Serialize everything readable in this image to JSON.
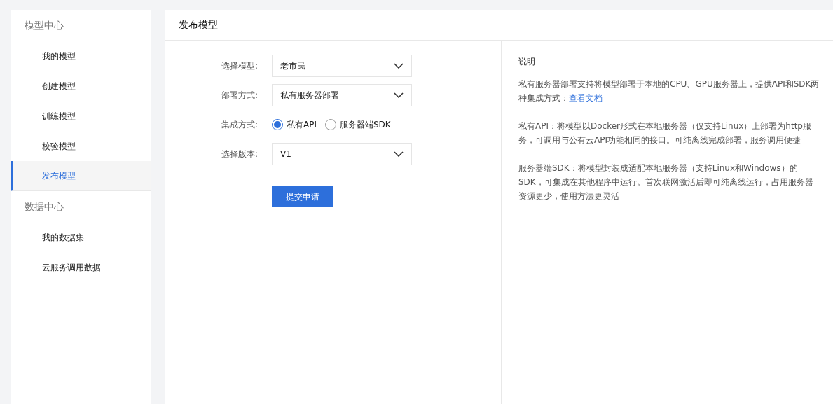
{
  "sidebar": {
    "groups": [
      {
        "title": "模型中心",
        "items": [
          {
            "label": "我的模型",
            "selected": false
          },
          {
            "label": "创建模型",
            "selected": false
          },
          {
            "label": "训练模型",
            "selected": false
          },
          {
            "label": "校验模型",
            "selected": false
          },
          {
            "label": "发布模型",
            "selected": true
          }
        ]
      },
      {
        "title": "数据中心",
        "items": [
          {
            "label": "我的数据集",
            "selected": false
          },
          {
            "label": "云服务调用数据",
            "selected": false
          }
        ]
      }
    ]
  },
  "page_title": "发布模型",
  "form": {
    "fields": [
      {
        "kind": "select",
        "label": "选择模型:",
        "value": "老市民"
      },
      {
        "kind": "select",
        "label": "部署方式:",
        "value": "私有服务器部署"
      },
      {
        "kind": "radio",
        "label": "集成方式:",
        "options": [
          {
            "label": "私有API",
            "selected": true
          },
          {
            "label": "服务器端SDK",
            "selected": false
          }
        ]
      },
      {
        "kind": "select",
        "label": "选择版本:",
        "value": "V1"
      }
    ],
    "submit": "提交申请"
  },
  "info": {
    "title": "说明",
    "paragraphs": [
      {
        "text": "私有服务器部署支持将模型部署于本地的CPU、GPU服务器上，提供API和SDK两种集成方式：",
        "link": "查看文档"
      },
      {
        "text": "私有API：将模型以Docker形式在本地服务器（仅支持Linux）上部署为http服务，可调用与公有云API功能相同的接口。可纯离线完成部署，服务调用便捷"
      },
      {
        "text": "服务器端SDK：将模型封装成适配本地服务器（支持Linux和Windows）的SDK，可集成在其他程序中运行。首次联网激活后即可纯离线运行，占用服务器资源更少，使用方法更灵活"
      }
    ]
  }
}
